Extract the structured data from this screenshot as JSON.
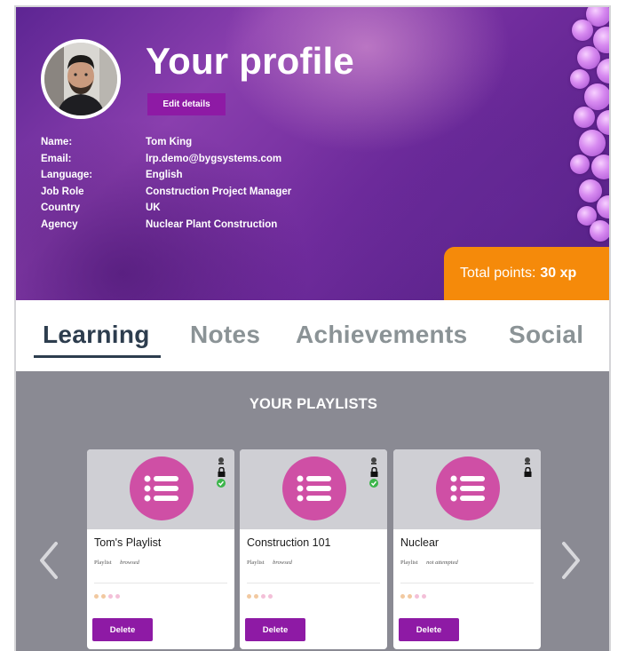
{
  "profile": {
    "title": "Your profile",
    "edit_label": "Edit details",
    "fields": [
      {
        "key": "Name:",
        "value": "Tom King"
      },
      {
        "key": "Email:",
        "value": "lrp.demo@bygsystems.com"
      },
      {
        "key": "Language:",
        "value": "English"
      },
      {
        "key": "Job Role",
        "value": "Construction Project Manager"
      },
      {
        "key": "Country",
        "value": "UK"
      },
      {
        "key": "Agency",
        "value": "Nuclear Plant Construction"
      }
    ],
    "points_label": "Total points:",
    "points_value": "30 xp"
  },
  "tabs": [
    {
      "label": "Learning",
      "active": true
    },
    {
      "label": "Notes",
      "active": false
    },
    {
      "label": "Achievements",
      "active": false
    },
    {
      "label": "Social",
      "active": false
    }
  ],
  "playlists": {
    "section_title": "YOUR PLAYLISTS",
    "cards": [
      {
        "name": "Tom's Playlist",
        "type": "Playlist",
        "status": "browsed",
        "delete_label": "Delete",
        "completed": true
      },
      {
        "name": "Construction 101",
        "type": "Playlist",
        "status": "browsed",
        "delete_label": "Delete",
        "completed": true
      },
      {
        "name": "Nuclear",
        "type": "Playlist",
        "status": "not attempted",
        "delete_label": "Delete",
        "completed": false
      }
    ]
  },
  "colors": {
    "accent_purple": "#8e1aa5",
    "points_orange": "#f58a0a",
    "playlist_icon_pink": "#cf4fa5",
    "tab_active": "#2d3d4e",
    "tab_inactive": "#8b9396",
    "section_bg": "#8a8a93"
  },
  "icons": {
    "playlist": "list-icon",
    "prev": "chevron-left-icon",
    "next": "chevron-right-icon",
    "complete": "check-circle-icon",
    "locked": "lock-icon"
  }
}
